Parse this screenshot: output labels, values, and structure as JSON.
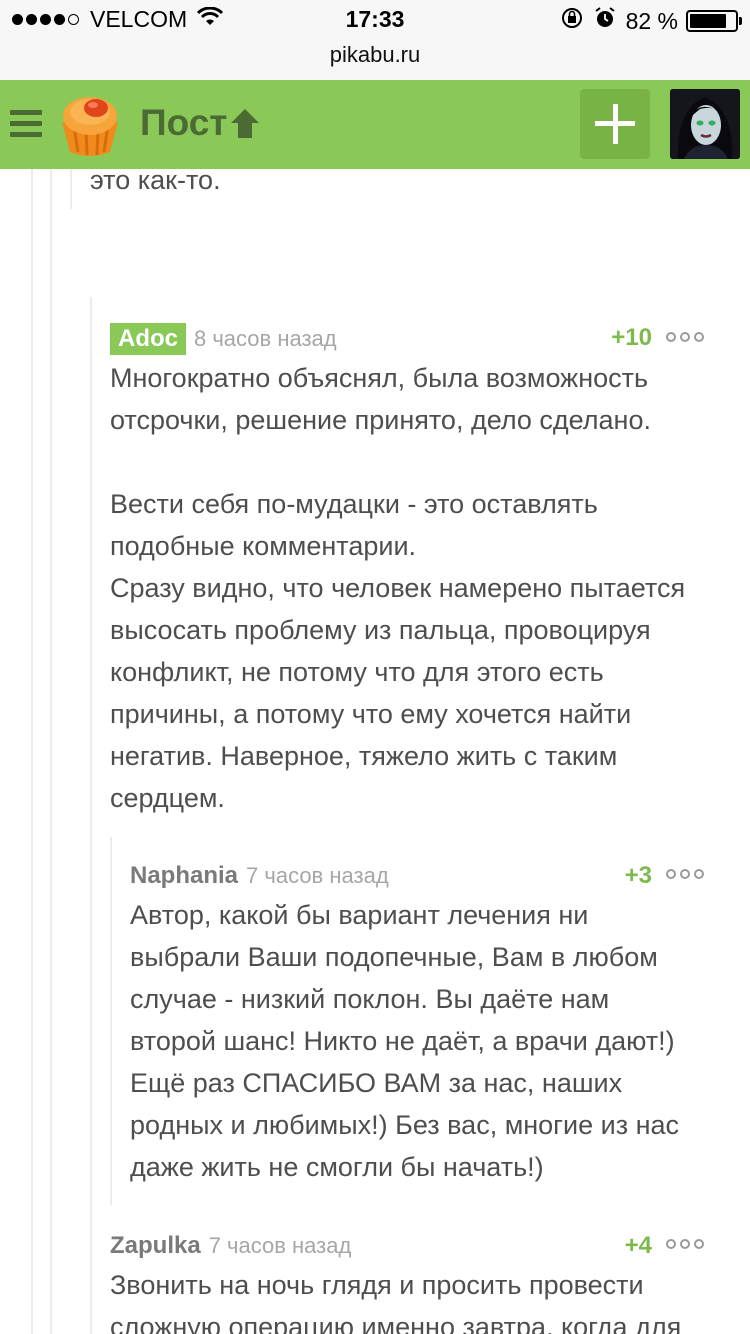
{
  "status_bar": {
    "carrier": "VELCOM",
    "time": "17:33",
    "battery": "82 %",
    "battery_level": 0.82,
    "url": "pikabu.ru"
  },
  "header": {
    "title": "Пост",
    "brand_color": "#8ac858",
    "icons": [
      "menu-icon",
      "pikabu-logo",
      "arrow-up-icon",
      "add-post-icon",
      "user-avatar"
    ]
  },
  "comments": {
    "prev_tail": "это как-то.",
    "c1": {
      "author": "Adoc",
      "time": "8 часов назад",
      "rating": "+10",
      "lines": [
        "Многократно объяснял, была возможность",
        "отсрочки, решение принято, дело сделано.",
        "",
        "Вести себя по-мудацки - это оставлять",
        "подобные комментарии.",
        "Сразу видно, что человек намерено пытается",
        "высосать проблему из пальца, провоцируя",
        "конфликт, не потому что для этого есть",
        "причины, а потому что ему хочется найти",
        "негатив. Наверное, тяжело жить с таким",
        "сердцем."
      ]
    },
    "c2": {
      "author": "Naphania",
      "time": "7 часов назад",
      "rating": "+3",
      "lines": [
        "Автор, какой бы вариант лечения ни",
        "выбрали Ваши подопечные, Вам в любом",
        "случае - низкий поклон. Вы даёте нам",
        "второй шанс! Никто не даёт, а врачи дают!)",
        "Ещё раз СПАСИБО ВАМ за нас, наших",
        "родных и любимых!) Без вас, многие из нас",
        "даже жить не смогли бы начать!)"
      ]
    },
    "c3": {
      "author": "Zapulka",
      "time": "7 часов назад",
      "rating": "+4",
      "lines": [
        "Звонить на ночь глядя и просить провести",
        "сложную операцию именно завтра, когда для"
      ]
    }
  }
}
